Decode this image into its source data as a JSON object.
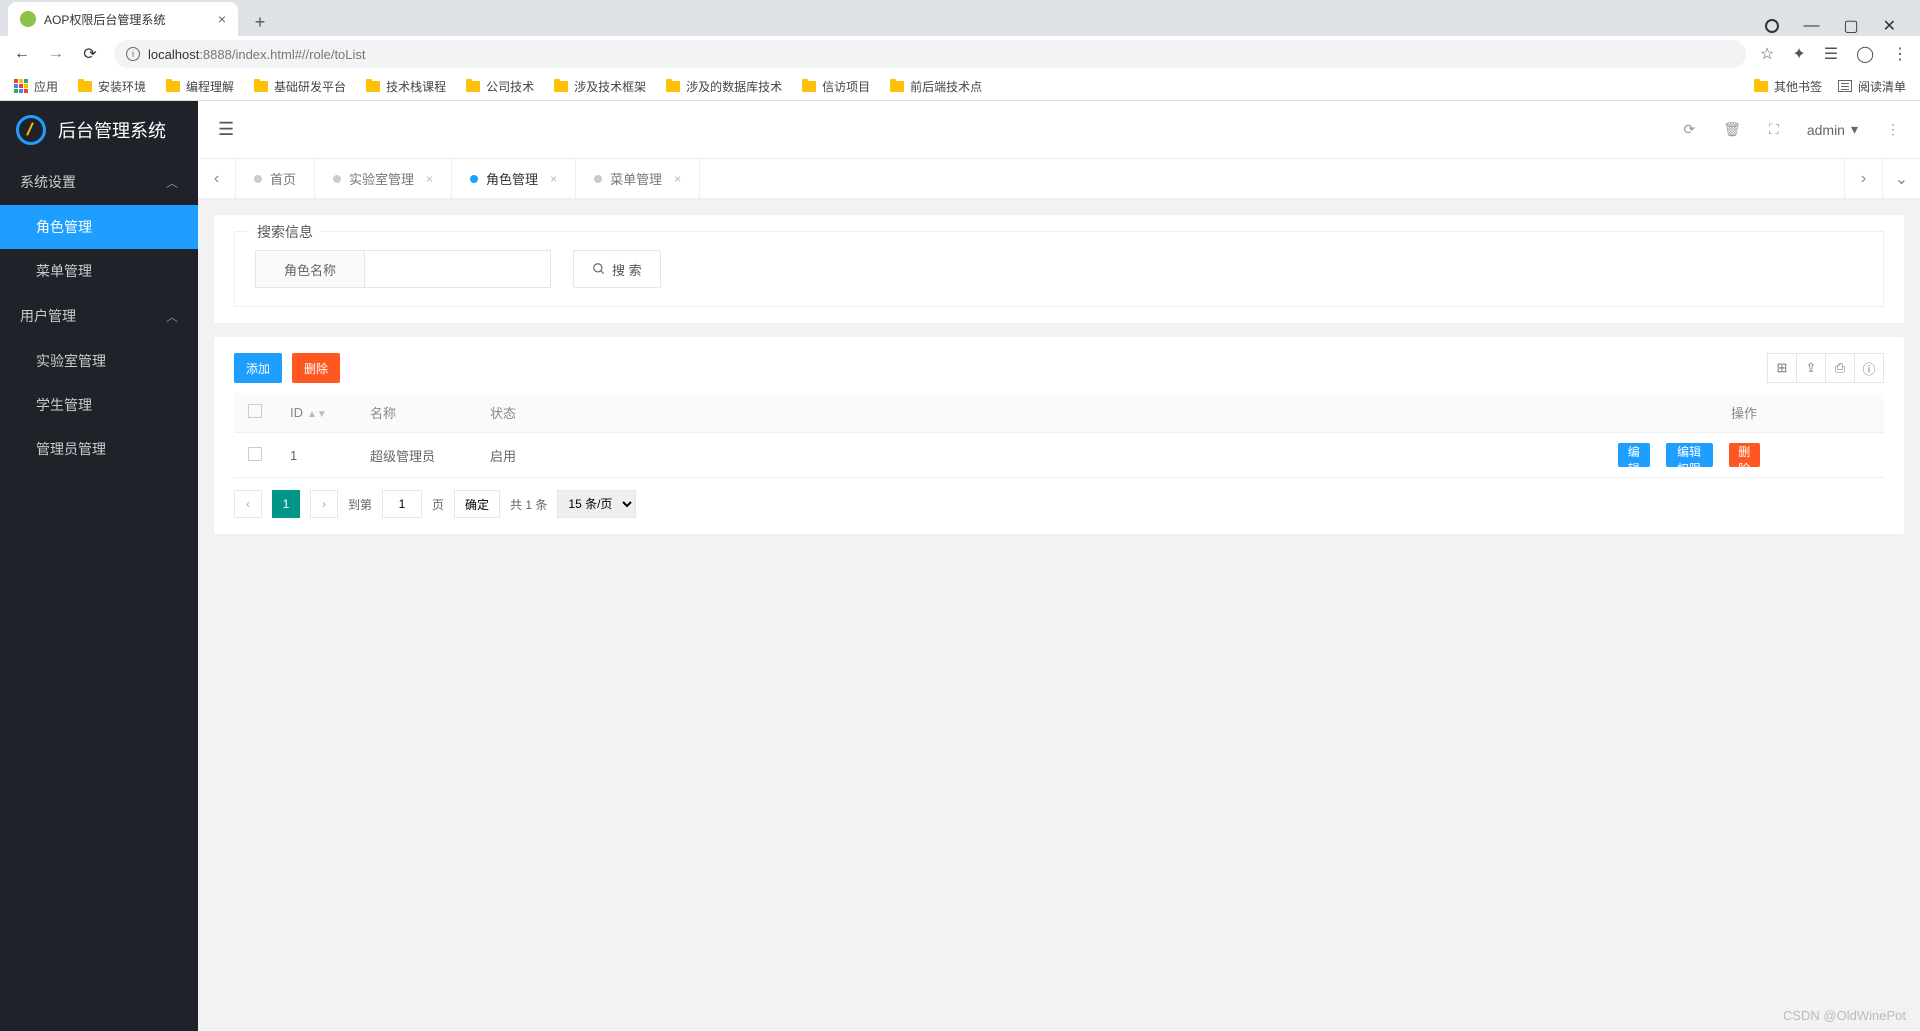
{
  "browser": {
    "tab_title": "AOP权限后台管理系统",
    "url_host": "localhost",
    "url_port_path": ":8888/index.html#//role/toList",
    "bookmarks": {
      "apps": "应用",
      "items": [
        "安装环境",
        "编程理解",
        "基础研发平台",
        "技术栈课程",
        "公司技术",
        "涉及技术框架",
        "涉及的数据库技术",
        "信访项目",
        "前后端技术点"
      ],
      "other": "其他书签",
      "reading_list": "阅读清单"
    }
  },
  "app": {
    "title": "后台管理系统",
    "user": "admin",
    "sidebar": {
      "groups": [
        {
          "title": "系统设置",
          "items": [
            "角色管理",
            "菜单管理"
          ],
          "active": 0
        },
        {
          "title": "用户管理",
          "items": [
            "实验室管理",
            "学生管理",
            "管理员管理"
          ],
          "active": -1
        }
      ]
    },
    "tabs": [
      {
        "label": "首页",
        "closable": false,
        "active": false
      },
      {
        "label": "实验室管理",
        "closable": true,
        "active": false
      },
      {
        "label": "角色管理",
        "closable": true,
        "active": true
      },
      {
        "label": "菜单管理",
        "closable": true,
        "active": false
      }
    ],
    "search": {
      "legend": "搜索信息",
      "label": "角色名称",
      "value": "",
      "button": "搜 索"
    },
    "actions": {
      "add": "添加",
      "delete": "删除"
    },
    "table": {
      "headers": {
        "id": "ID",
        "name": "名称",
        "status": "状态",
        "ops": "操作"
      },
      "rows": [
        {
          "id": "1",
          "name": "超级管理员",
          "status": "启用",
          "ops": {
            "edit": "编辑",
            "perm": "编辑权限",
            "del": "删除"
          }
        }
      ]
    },
    "pager": {
      "current": "1",
      "goto_prefix": "到第",
      "goto_value": "1",
      "goto_suffix": "页",
      "confirm": "确定",
      "total": "共 1 条",
      "per_page": "15 条/页"
    }
  },
  "watermark": "CSDN @OldWinePot"
}
